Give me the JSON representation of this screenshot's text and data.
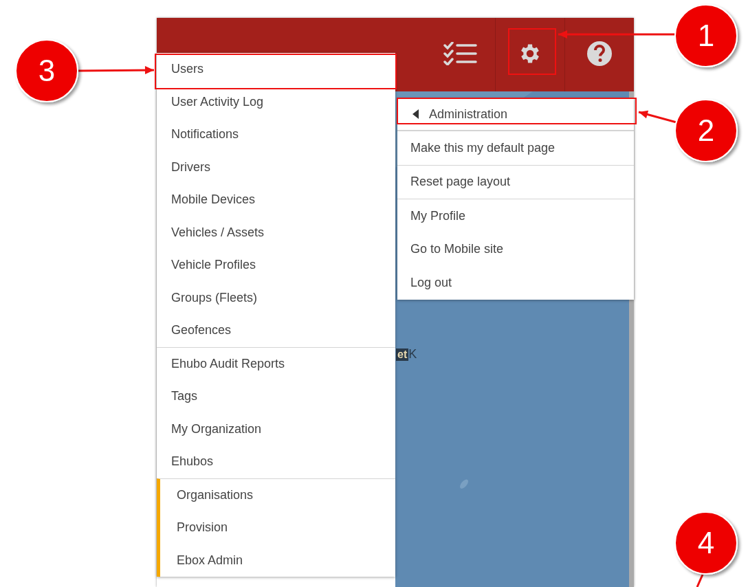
{
  "main_menu": {
    "groups": [
      {
        "accent": false,
        "items": [
          "Users",
          "User Activity Log",
          "Notifications",
          "Drivers",
          "Mobile Devices",
          "Vehicles / Assets",
          "Vehicle Profiles",
          "Groups (Fleets)",
          "Geofences"
        ]
      },
      {
        "accent": false,
        "items": [
          "Ehubo Audit Reports",
          "Tags",
          "My Organization",
          "Ehubos"
        ]
      },
      {
        "accent": true,
        "items": [
          "Organisations",
          "Provision",
          "Ebox Admin"
        ]
      }
    ]
  },
  "settings_menu": {
    "back_label": "Administration",
    "groups": [
      [
        "Make this my default page"
      ],
      [
        "Reset page layout"
      ],
      [
        "My Profile",
        "Go to Mobile site",
        "Log out"
      ]
    ]
  },
  "map": {
    "labels": [
      "et",
      "K"
    ]
  },
  "annotations": [
    {
      "label": "1"
    },
    {
      "label": "2"
    },
    {
      "label": "3"
    },
    {
      "label": "4"
    }
  ]
}
